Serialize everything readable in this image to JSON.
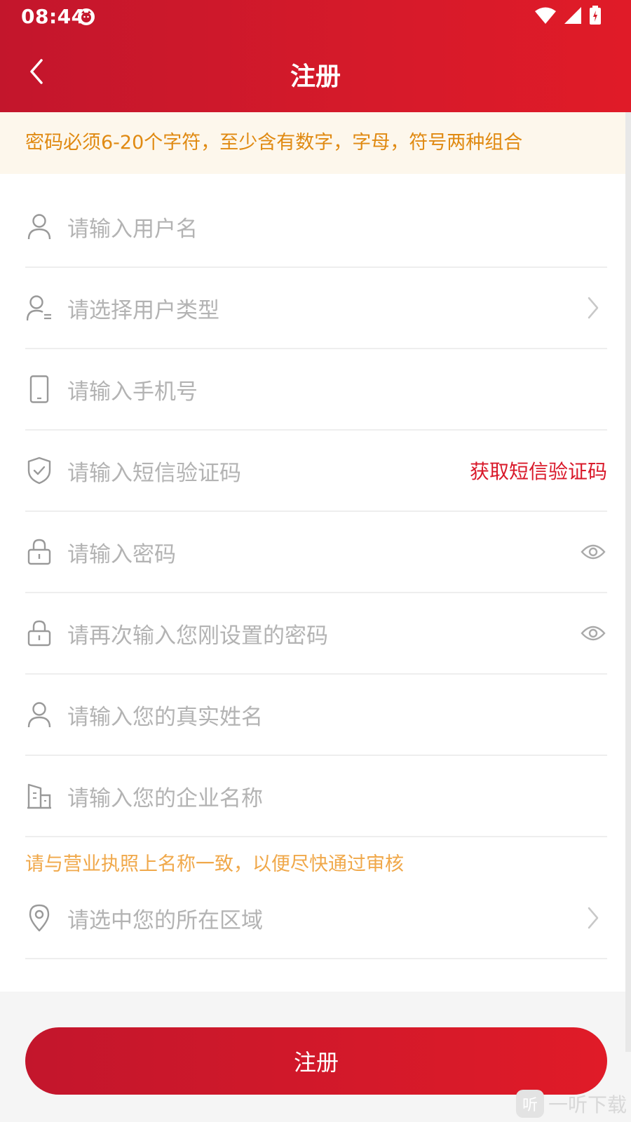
{
  "status_bar": {
    "time": "08:44"
  },
  "nav": {
    "title": "注册"
  },
  "notice": "密码必须6-20个字符，至少含有数字，字母，符号两种组合",
  "form": {
    "username_placeholder": "请输入用户名",
    "user_type_placeholder": "请选择用户类型",
    "phone_placeholder": "请输入手机号",
    "sms_code_placeholder": "请输入短信验证码",
    "get_sms_code_label": "获取短信验证码",
    "password_placeholder": "请输入密码",
    "confirm_password_placeholder": "请再次输入您刚设置的密码",
    "real_name_placeholder": "请输入您的真实姓名",
    "company_name_placeholder": "请输入您的企业名称",
    "company_hint": "请与营业执照上名称一致，以便尽快通过审核",
    "region_placeholder": "请选中您的所在区域"
  },
  "submit": {
    "label": "注册"
  },
  "watermark": {
    "badge": "听",
    "text": "一听下载"
  },
  "colors": {
    "primary": "#d61a2a",
    "notice_text": "#e08a12",
    "hint_text": "#f0a84a"
  }
}
